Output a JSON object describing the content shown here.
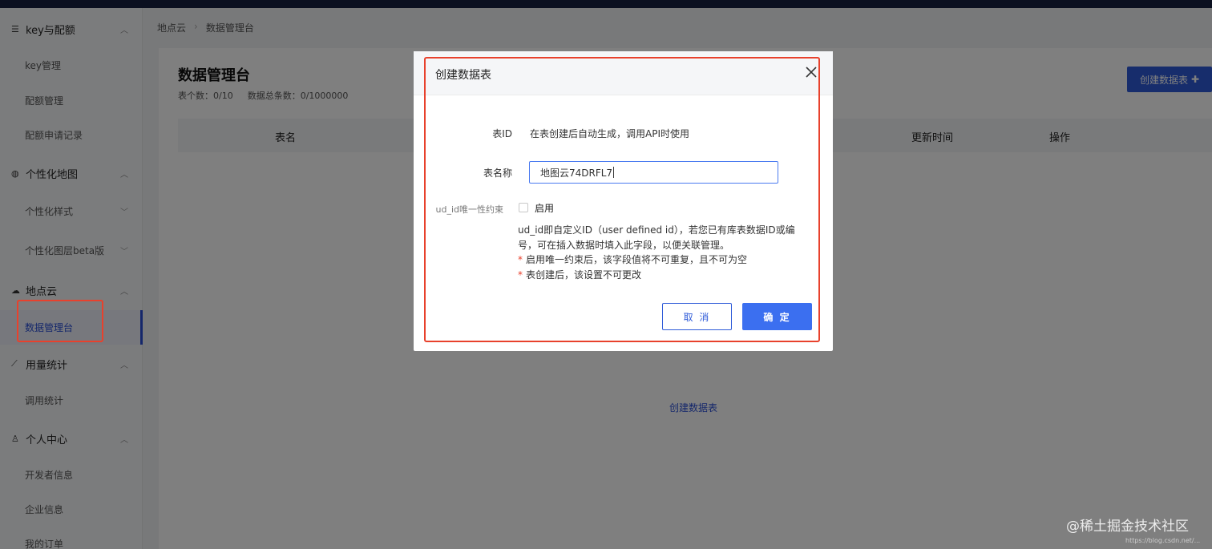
{
  "sidebar": {
    "groups": [
      {
        "label": "key与配额",
        "icon": "list-icon",
        "items": [
          "key管理",
          "配额管理",
          "配额申请记录"
        ]
      },
      {
        "label": "个性化地图",
        "icon": "palette-icon",
        "items": [
          "个性化样式",
          "个性化图层beta版"
        ]
      },
      {
        "label": "地点云",
        "icon": "cloud-icon",
        "items": [
          "数据管理台"
        ]
      },
      {
        "label": "用量统计",
        "icon": "chart-icon",
        "items": [
          "调用统计"
        ]
      },
      {
        "label": "个人中心",
        "icon": "user-icon",
        "items": [
          "开发者信息",
          "企业信息",
          "我的订单"
        ]
      }
    ],
    "active_item": "数据管理台"
  },
  "breadcrumb": [
    "地点云",
    "数据管理台"
  ],
  "page": {
    "title": "数据管理台",
    "table_count": "表个数：0/10",
    "record_count": "数据总条数：0/1000000",
    "create_button": "创建数据表",
    "columns": [
      "表名",
      "更新时间",
      "操作"
    ],
    "empty_create_link": "创建数据表"
  },
  "modal": {
    "title": "创建数据表",
    "table_id_label": "表ID",
    "table_id_hint": "在表创建后自动生成，调用API时使用",
    "table_name_label": "表名称",
    "table_name_value": "地图云74DRFL7",
    "unique_label": "ud_id唯一性约束",
    "enable_label": "启用",
    "enable_checked": false,
    "desc_line1": "ud_id即自定义ID（user defined id），若您已有库表数据ID或编号，可在插入数据时填入此字段，以便关联管理。",
    "note1": "启用唯一约束后，该字段值将不可重复，且不可为空",
    "note2": "表创建后，该设置不可更改",
    "cancel_label": "取 消",
    "ok_label": "确 定"
  },
  "colors": {
    "accent": "#2f5bd8",
    "highlight": "#e8412c"
  },
  "watermark": "@稀土掘金技术社区",
  "watermark_small": "https://blog.csdn.net/..."
}
